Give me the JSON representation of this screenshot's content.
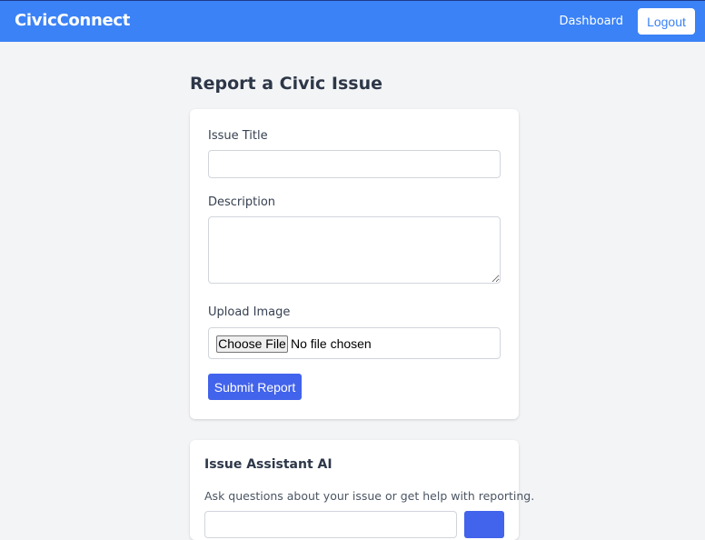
{
  "header": {
    "brand": "CivicConnect",
    "nav_dashboard": "Dashboard",
    "logout_label": "Logout"
  },
  "page": {
    "title": "Report a Civic Issue"
  },
  "form": {
    "title_label": "Issue Title",
    "title_value": "",
    "description_label": "Description",
    "description_value": "",
    "image_label": "Upload Image",
    "file_button_label": "Choose File",
    "file_status": "No file chosen",
    "submit_label": "Submit Report"
  },
  "assistant": {
    "title": "Issue Assistant AI",
    "description": "Ask questions about your issue or get help with reporting.",
    "input_value": ""
  },
  "colors": {
    "navbar": "#3b82f6",
    "primary_button": "#4263eb",
    "background": "#f3f4f6"
  }
}
